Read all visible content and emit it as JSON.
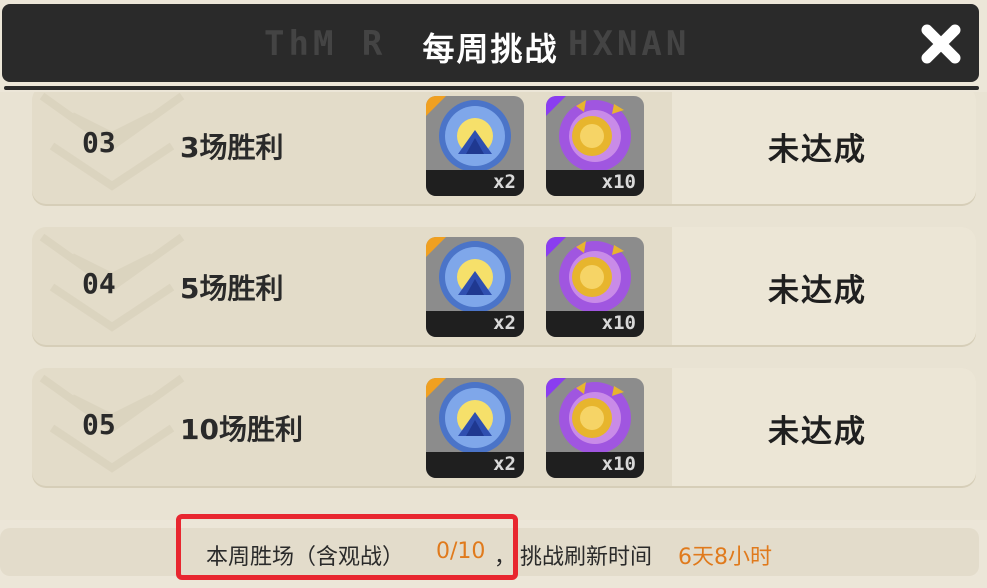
{
  "header": {
    "title": "每周挑战",
    "deco_left": "ThM R",
    "deco_right": "HXNAN"
  },
  "rows": [
    {
      "index": "03",
      "task": "3场胜利",
      "rewards": [
        {
          "icon": "blue-crystal-icon",
          "count": "x2",
          "corner_color": "#f0a020"
        },
        {
          "icon": "gold-coin-purple-gear-icon",
          "count": "x10",
          "corner_color": "#8a3df0"
        }
      ],
      "status": "未达成"
    },
    {
      "index": "04",
      "task": "5场胜利",
      "rewards": [
        {
          "icon": "blue-crystal-icon",
          "count": "x2",
          "corner_color": "#f0a020"
        },
        {
          "icon": "gold-coin-purple-gear-icon",
          "count": "x10",
          "corner_color": "#8a3df0"
        }
      ],
      "status": "未达成"
    },
    {
      "index": "05",
      "task": "10场胜利",
      "rewards": [
        {
          "icon": "blue-crystal-icon",
          "count": "x2",
          "corner_color": "#f0a020"
        },
        {
          "icon": "gold-coin-purple-gear-icon",
          "count": "x10",
          "corner_color": "#8a3df0"
        }
      ],
      "status": "未达成"
    }
  ],
  "footer": {
    "wins_label": "本周胜场（含观战）",
    "wins_value": "0/10",
    "separator": "，",
    "refresh_label": "挑战刷新时间",
    "refresh_value": "6天8小时"
  },
  "colors": {
    "accent_orange": "#e07a1c",
    "highlight_red": "#e8262f",
    "header_bg": "#2a2a2a"
  }
}
